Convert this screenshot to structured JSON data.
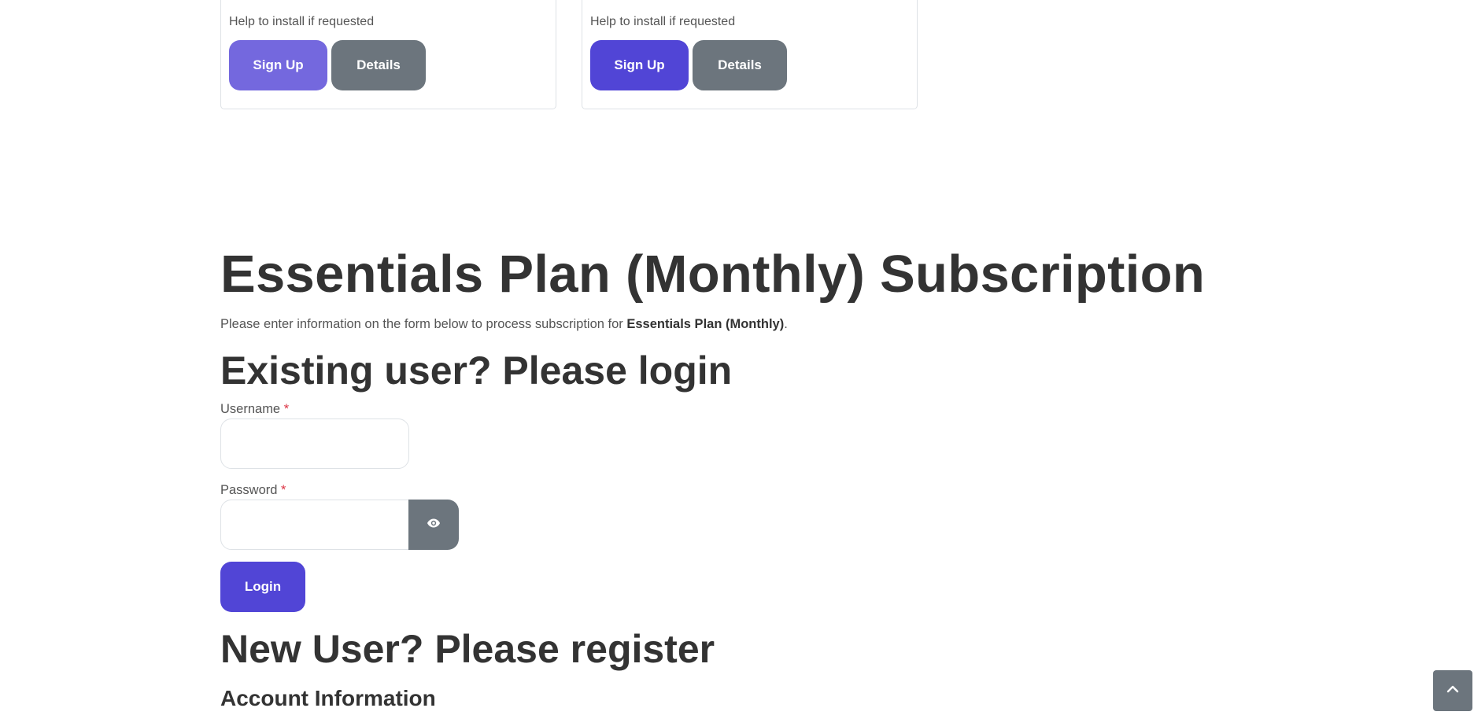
{
  "plans": [
    {
      "note": "Help to install if requested",
      "signup_label": "Sign Up",
      "details_label": "Details"
    },
    {
      "note": "Help to install if requested",
      "signup_label": "Sign Up",
      "details_label": "Details"
    }
  ],
  "subscription": {
    "title": "Essentials Plan (Monthly) Subscription",
    "intro_prefix": "Please enter information on the form below to process subscription for ",
    "intro_plan": "Essentials Plan (Monthly)",
    "intro_suffix": "."
  },
  "login": {
    "heading": "Existing user? Please login",
    "username_label": "Username",
    "password_label": "Password",
    "required_marker": "*",
    "username_value": "",
    "password_value": "",
    "toggle_icon": "eye-icon",
    "login_label": "Login"
  },
  "register": {
    "heading": "New User? Please register",
    "section_title": "Account Information"
  },
  "back_to_top_icon": "chevron-up-icon",
  "colors": {
    "primary": "#5145d6",
    "primary_hover": "#7468de",
    "secondary": "#6c757d",
    "required": "#dc3545",
    "text": "#333333"
  }
}
